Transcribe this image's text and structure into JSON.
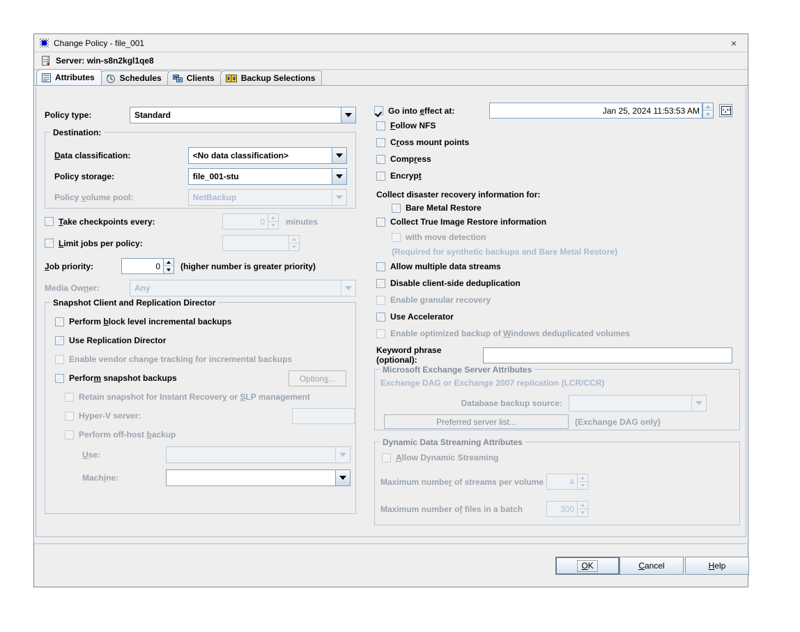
{
  "window": {
    "title": "Change Policy - file_001",
    "close_label": "×",
    "icon": "policy-icon"
  },
  "server": {
    "label": "Server: win-s8n2kgl1qe8",
    "icon": "server-icon"
  },
  "tabs": [
    {
      "label": "Attributes",
      "icon": "attributes-icon",
      "active": true
    },
    {
      "label": "Schedules",
      "icon": "schedules-icon",
      "active": false
    },
    {
      "label": "Clients",
      "icon": "clients-icon",
      "active": false
    },
    {
      "label": "Backup Selections",
      "icon": "backup-selections-icon",
      "active": false
    }
  ],
  "left": {
    "policy_type_label": "Policy type:",
    "policy_type_value": "Standard",
    "destination": {
      "title": "Destination:",
      "data_classification_label": "Data classification:",
      "data_classification_value": "<No data classification>",
      "policy_storage_label": "Policy storage:",
      "policy_storage_value": "file_001-stu",
      "policy_volume_pool_label": "Policy volume pool:",
      "policy_volume_pool_value": "NetBackup"
    },
    "take_checkpoints_label": "Take checkpoints every:",
    "take_checkpoints_value": "0",
    "minutes_label": "minutes",
    "limit_jobs_label": "Limit jobs per policy:",
    "limit_jobs_value": "",
    "job_priority_label": "Job priority:",
    "job_priority_value": "0",
    "job_priority_hint": "(higher number is greater priority)",
    "media_owner_label": "Media Owner:",
    "media_owner_value": "Any",
    "snapshot_group": {
      "title": "Snapshot Client and Replication Director",
      "block_level_label": "Perform block level incremental backups",
      "replication_director_label": "Use Replication Director",
      "vendor_change_label": "Enable vendor change tracking for incremental backups",
      "snapshot_backups_label": "Perform snapshot backups",
      "options_button": "Options...",
      "retain_snapshot_label": "Retain snapshot for Instant Recovery or SLP management",
      "hyperv_label": "Hyper-V server:",
      "hyperv_value": "",
      "offhost_label": "Perform off-host backup",
      "use_label": "Use:",
      "use_value": "",
      "machine_label": "Machine:",
      "machine_value": ""
    }
  },
  "right": {
    "go_into_effect_label": "Go into effect at:",
    "go_into_effect_value": "Jan 25, 2024 11:53:53 AM",
    "calendar_icon": "calendar-icon",
    "follow_nfs_label": "Follow NFS",
    "cross_mount_label": "Cross mount points",
    "compress_label": "Compress",
    "encrypt_label": "Encrypt",
    "collect_dr_label": "Collect disaster recovery information for:",
    "bare_metal_label": "Bare Metal Restore",
    "collect_tir_label": "Collect True Image Restore information",
    "with_move_detection_label": "with move detection",
    "required_note": "(Required for synthetic backups and Bare Metal Restore)",
    "allow_multiple_streams_label": "Allow multiple data streams",
    "disable_client_dedup_label": "Disable client-side deduplication",
    "granular_recovery_label": "Enable granular recovery",
    "use_accelerator_label": "Use Accelerator",
    "optimized_windows_label": "Enable optimized backup of Windows deduplicated volumes",
    "keyword_phrase_label": "Keyword phrase (optional):",
    "keyword_phrase_value": "",
    "exchange_group": {
      "title": "Microsoft Exchange Server Attributes",
      "dag_note": "Exchange DAG or Exchange 2007 replication (LCR/CCR)",
      "db_backup_source_label": "Database backup source:",
      "db_backup_source_value": "",
      "preferred_server_button": "Preferred server list...",
      "dag_only_note": "(Exchange DAG only)"
    },
    "dynamic_group": {
      "title": "Dynamic Data Streaming Attributes",
      "allow_dynamic_label": "Allow Dynamic Streaming",
      "max_streams_label": "Maximum number of streams per volume",
      "max_streams_value": "4",
      "max_files_label": "Maximum number of files in a batch",
      "max_files_value": "300"
    }
  },
  "footer": {
    "ok_label": "OK",
    "cancel_label": "Cancel",
    "help_label": "Help"
  },
  "colors": {
    "dialog_bg": "#eeeeee",
    "border": "#7f9db9",
    "disabled_text": "#9aa4ae",
    "note_blue": "#a9bad0"
  }
}
